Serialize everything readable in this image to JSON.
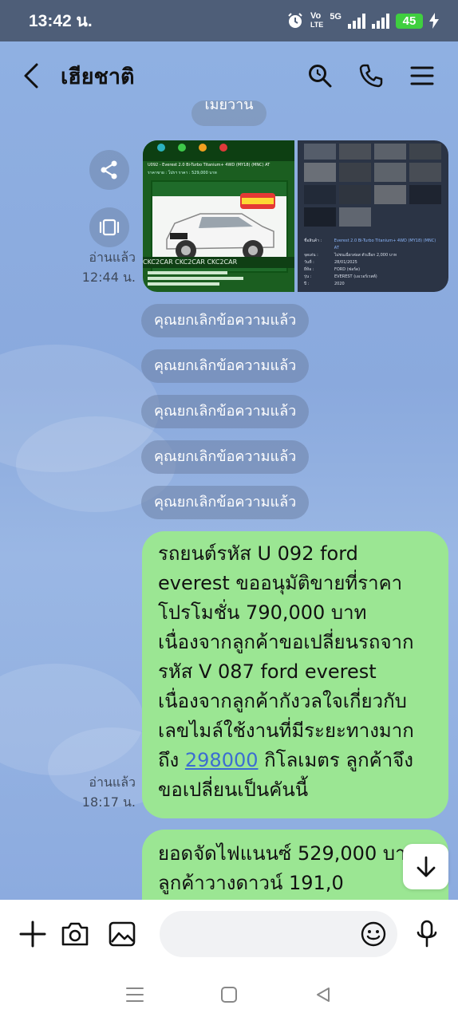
{
  "status_bar": {
    "time": "13:42 น.",
    "network_label_top": "Vo",
    "network_label_bottom": "LTE",
    "network_type": "5G",
    "battery": "45"
  },
  "header": {
    "title": "เฮียชาติ",
    "icons": [
      "back-icon",
      "search-icon",
      "phone-icon",
      "menu-icon"
    ]
  },
  "chat": {
    "system_top": "เมียวาน",
    "image_message": {
      "read_status": "อ่านแล้ว",
      "time": "12:44 น.",
      "left_title": "U092 - Everest 2.0 Bi-Turbo Titanium+ 4WD (MY18) (MNC) AT",
      "left_price": "ราคาขาย : โปรฯ ราคา : 529,000 บาท",
      "left_brand": "CKC2CAR CKC2CAR CKC2CAR",
      "right_rows": [
        [
          "ชื่อสินค้า :",
          "Everest 2.0 Bi-Turbo Titanium+ 4WD (MY18) (MNC) AT"
        ],
        [
          "จุดเด่น :",
          "ไม่ชนเฉี่ยวต่อส ตัวเลือก 2,000 บาท"
        ],
        [
          "วันที่ :",
          "28/01/2025"
        ],
        [
          "ยี่ห้อ :",
          "FORD (ฟอร์ด)"
        ],
        [
          "รุ่น :",
          "EVEREST (เอเวอร์เรสต์)"
        ],
        [
          "ปี :",
          "2020"
        ]
      ]
    },
    "cancelled": [
      "คุณยกเลิกข้อความแล้ว",
      "คุณยกเลิกข้อความแล้ว",
      "คุณยกเลิกข้อความแล้ว",
      "คุณยกเลิกข้อความแล้ว",
      "คุณยกเลิกข้อความแล้ว"
    ],
    "message1": {
      "text_before": "รถยนต์รหัส U 092 ford everest ขออนุมัติขายที่ราคาโปรโมชั่น 790,000 บาท เนื่องจากลูกค้าขอเปลี่ยนรถจากรหัส V 087 ford everest เนื่องจากลูกค้ากังวลใจเกี่ยวกับเลขไมล์ใช้งานที่มีระยะทางมากถึง ",
      "link": "298000",
      "text_after": " กิโลเมตร ลูกค้าจึงขอเปลี่ยนเป็นคันนี้",
      "read_status": "อ่านแล้ว",
      "time": "18:17 น."
    },
    "message2": {
      "text": "ยอดจัดไฟแนนซ์ 529,000 บาท ลูกค้าวางดาวน์ 191,0"
    }
  },
  "input_bar": {
    "placeholder": "",
    "icons": [
      "plus-icon",
      "camera-icon",
      "image-icon",
      "emoji-icon",
      "microphone-icon"
    ]
  },
  "nav_bar": {
    "icons": [
      "recent-apps-icon",
      "home-icon",
      "back-nav-icon"
    ]
  },
  "colors": {
    "status_bar": "#4e5e78",
    "chat_background": "#8eaee0",
    "sent_bubble": "#9be693",
    "link": "#3c6dd1",
    "battery": "#3fcf3f"
  }
}
